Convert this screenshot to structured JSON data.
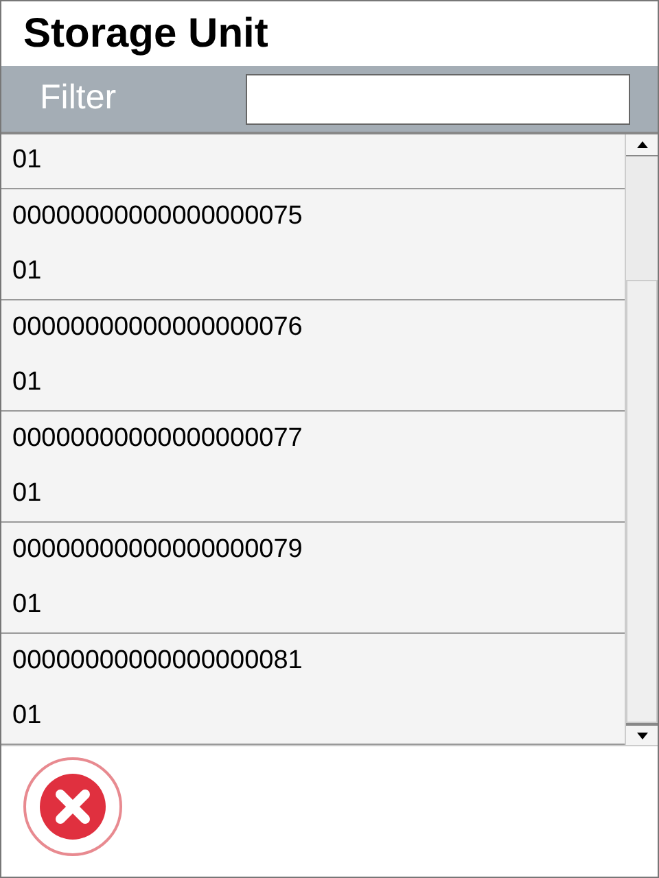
{
  "window": {
    "title": "Storage Unit"
  },
  "filter": {
    "label": "Filter"
  },
  "rows": [
    {
      "lines": [
        "01"
      ]
    },
    {
      "lines": [
        "00000000000000000075",
        "01"
      ]
    },
    {
      "lines": [
        "00000000000000000076",
        "01"
      ]
    },
    {
      "lines": [
        "00000000000000000077",
        "01"
      ]
    },
    {
      "lines": [
        "00000000000000000079",
        "01"
      ]
    },
    {
      "lines": [
        "00000000000000000081",
        "01"
      ]
    }
  ]
}
